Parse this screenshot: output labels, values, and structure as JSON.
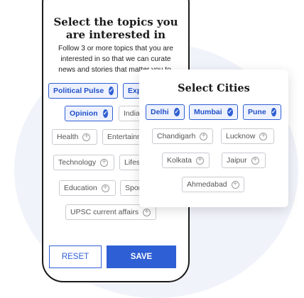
{
  "topics_screen": {
    "title_line1": "Select the topics you",
    "title_line2": "are interested in",
    "subtitle_lines": [
      "Follow 3 or more topics that you are",
      "interested in so that we can curate",
      "news and stories that matter you to."
    ],
    "topics": [
      {
        "label": "Political Pulse",
        "selected": true
      },
      {
        "label": "Exp",
        "selected": false
      },
      {
        "label": "Opinion",
        "selected": true
      },
      {
        "label": "India",
        "selected": false
      },
      {
        "label": "Health",
        "selected": false
      },
      {
        "label": "Entertainm",
        "selected": false
      },
      {
        "label": "Technology",
        "selected": false
      },
      {
        "label": "Lifes",
        "selected": false
      },
      {
        "label": "Education",
        "selected": false
      },
      {
        "label": "Spor",
        "selected": false
      },
      {
        "label": "UPSC current affairs",
        "selected": false
      }
    ],
    "reset_label": "RESET",
    "save_label": "SAVE"
  },
  "cities_card": {
    "title": "Select Cities",
    "cities": [
      {
        "label": "Delhi",
        "selected": true
      },
      {
        "label": "Mumbai",
        "selected": true
      },
      {
        "label": "Pune",
        "selected": true
      },
      {
        "label": "Chandigarh",
        "selected": false
      },
      {
        "label": "Lucknow",
        "selected": false
      },
      {
        "label": "Kolkata",
        "selected": false
      },
      {
        "label": "Jaipur",
        "selected": false
      },
      {
        "label": "Ahmedabad",
        "selected": false
      }
    ]
  },
  "colors": {
    "accent": "#2f5fd4",
    "selected_bg": "#eef2ff",
    "border": "#c9cbd1"
  },
  "icons": {
    "selected": "check-circle-icon",
    "unselected": "plus-circle-icon"
  }
}
